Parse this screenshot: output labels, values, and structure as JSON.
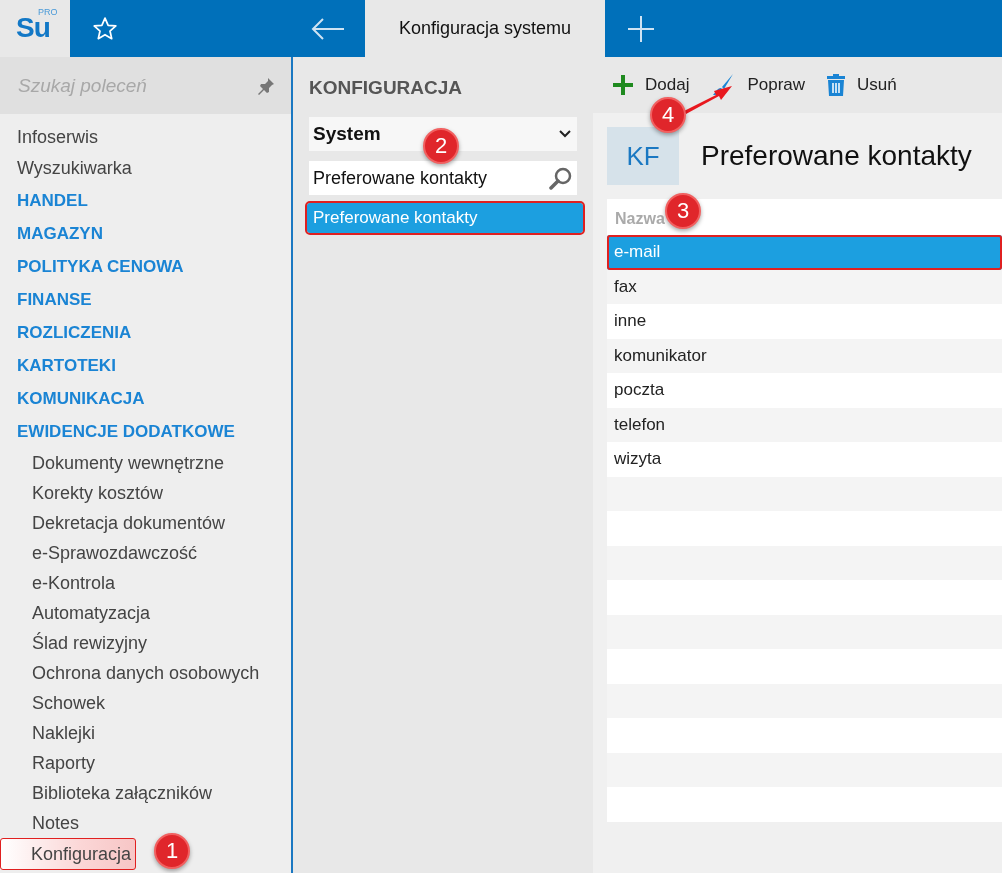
{
  "app": {
    "logo": "Su",
    "logo_badge": "PRO"
  },
  "tabs": [
    {
      "label": "Konfiguracja systemu",
      "selected": true
    }
  ],
  "sidebar": {
    "search": {
      "placeholder": "Szukaj poleceń"
    },
    "items": [
      {
        "label": "Infoserwis",
        "kind": "link",
        "annotated": false
      },
      {
        "label": "Wyszukiwarka",
        "kind": "link",
        "annotated": false
      },
      {
        "label": "HANDEL",
        "kind": "section",
        "annotated": false
      },
      {
        "label": "MAGAZYN",
        "kind": "section",
        "annotated": false
      },
      {
        "label": "POLITYKA CENOWA",
        "kind": "section",
        "annotated": false
      },
      {
        "label": "FINANSE",
        "kind": "section",
        "annotated": false
      },
      {
        "label": "ROZLICZENIA",
        "kind": "section",
        "annotated": false
      },
      {
        "label": "KARTOTEKI",
        "kind": "section",
        "annotated": false
      },
      {
        "label": "KOMUNIKACJA",
        "kind": "section",
        "annotated": false
      },
      {
        "label": "EWIDENCJE DODATKOWE",
        "kind": "section",
        "annotated": false
      },
      {
        "label": "Dokumenty wewnętrzne",
        "kind": "subitem",
        "annotated": false
      },
      {
        "label": "Korekty kosztów",
        "kind": "subitem",
        "annotated": false
      },
      {
        "label": "Dekretacja dokumentów",
        "kind": "subitem",
        "annotated": false
      },
      {
        "label": "e-Sprawozdawczość",
        "kind": "subitem",
        "annotated": false
      },
      {
        "label": "e-Kontrola",
        "kind": "subitem",
        "annotated": false
      },
      {
        "label": "Automatyzacja",
        "kind": "subitem",
        "annotated": false
      },
      {
        "label": "Ślad rewizyjny",
        "kind": "subitem",
        "annotated": false
      },
      {
        "label": "Ochrona danych osobowych",
        "kind": "subitem",
        "annotated": false
      },
      {
        "label": "Schowek",
        "kind": "subitem",
        "annotated": false
      },
      {
        "label": "Naklejki",
        "kind": "subitem",
        "annotated": false
      },
      {
        "label": "Raporty",
        "kind": "subitem",
        "annotated": false
      },
      {
        "label": "Biblioteka załączników",
        "kind": "subitem",
        "annotated": false
      },
      {
        "label": "Notes",
        "kind": "subitem",
        "annotated": false
      },
      {
        "label": "Konfiguracja",
        "kind": "subitem",
        "annotated": true
      }
    ]
  },
  "config_panel": {
    "title": "KONFIGURACJA",
    "dropdown": {
      "value": "System"
    },
    "search": {
      "value": "Preferowane kontakty"
    },
    "results": [
      {
        "label": "Preferowane kontakty",
        "selected": true,
        "annotated": true
      }
    ]
  },
  "toolbar": [
    {
      "label": "Dodaj",
      "kind": "add"
    },
    {
      "label": "Popraw",
      "kind": "edit"
    },
    {
      "label": "Usuń",
      "kind": "delete"
    }
  ],
  "detail": {
    "badge": "KF",
    "title": "Preferowane kontakty",
    "table": {
      "columns": [
        "Nazwa"
      ],
      "rows": [
        {
          "cells": [
            "e-mail"
          ],
          "selected": true,
          "annotated": true
        },
        {
          "cells": [
            "fax"
          ],
          "selected": false,
          "annotated": false
        },
        {
          "cells": [
            "inne"
          ],
          "selected": false,
          "annotated": false
        },
        {
          "cells": [
            "komunikator"
          ],
          "selected": false,
          "annotated": false
        },
        {
          "cells": [
            "poczta"
          ],
          "selected": false,
          "annotated": false
        },
        {
          "cells": [
            "telefon"
          ],
          "selected": false,
          "annotated": false
        },
        {
          "cells": [
            "wizyta"
          ],
          "selected": false,
          "annotated": false
        }
      ]
    }
  },
  "callouts": [
    {
      "number": "1"
    },
    {
      "number": "2"
    },
    {
      "number": "3"
    },
    {
      "number": "4"
    }
  ]
}
